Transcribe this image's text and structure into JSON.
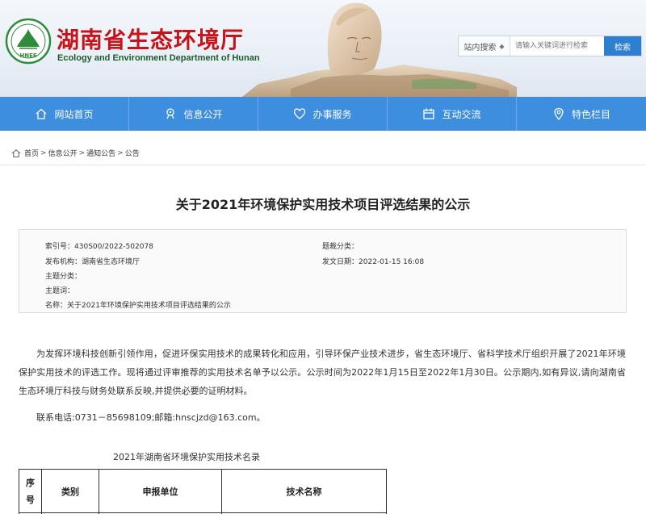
{
  "header": {
    "title": "湖南省生态环境厅",
    "subtitle": "Ecology and Environment Department of Hunan",
    "logo_text": "HNEE"
  },
  "search": {
    "scope": "站内搜索",
    "placeholder": "请输入关键词进行检索",
    "button": "检索"
  },
  "nav": [
    {
      "label": "网站首页",
      "icon": "home-icon"
    },
    {
      "label": "信息公开",
      "icon": "info-icon"
    },
    {
      "label": "办事服务",
      "icon": "heart-icon"
    },
    {
      "label": "互动交流",
      "icon": "calendar-icon"
    },
    {
      "label": "特色栏目",
      "icon": "location-icon"
    }
  ],
  "breadcrumb": [
    "首页",
    "信息公开",
    "通知公告",
    "公告"
  ],
  "article": {
    "title": "关于2021年环境保护实用技术项目评选结果的公示",
    "meta": {
      "index_label": "索引号：",
      "index_value": "430S00/2022-502078",
      "category_label": "题裁分类：",
      "category_value": "",
      "publisher_label": "发布机构：",
      "publisher_value": "湖南省生态环境厅",
      "date_label": "发文日期：",
      "date_value": "2022-01-15 16:08",
      "topic_label": "主题分类：",
      "topic_value": "",
      "keyword_label": "主题词：",
      "keyword_value": "",
      "name_label": "名称：",
      "name_value": "关于2021年环境保护实用技术项目评选结果的公示"
    },
    "paragraph1": "为发挥环境科技创新引领作用，促进环保实用技术的成果转化和应用，引导环保产业技术进步，省生态环境厅、省科学技术厅组织开展了2021年环境保护实用技术的评选工作。现将通过评审推荐的实用技术名单予以公示。公示时间为2022年1月15日至2022年1月30日。公示期内,如有异议,请向湖南省生态环境厅科技与财务处联系反映,并提供必要的证明材料。",
    "paragraph2": "联系电话:0731－85698109;邮箱:hnscjzd@163.com。",
    "table_caption": "2021年湖南省环境保护实用技术名录",
    "table_headers": [
      "序号",
      "类别",
      "申报单位",
      "技术名称"
    ]
  }
}
